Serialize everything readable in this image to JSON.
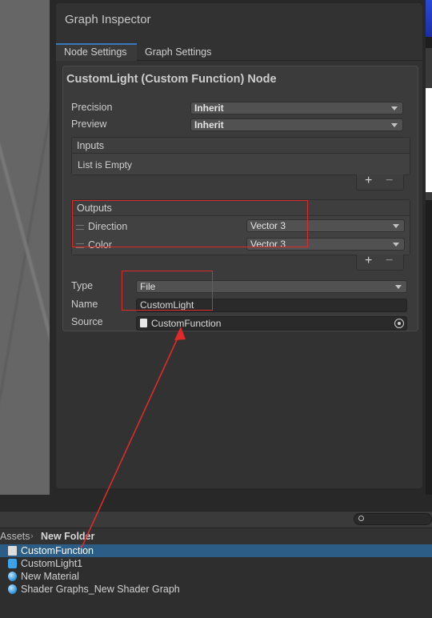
{
  "window": {
    "title": "Graph Inspector"
  },
  "tabs": [
    {
      "label": "Node Settings",
      "active": true
    },
    {
      "label": "Graph Settings",
      "active": false
    }
  ],
  "node": {
    "title": "CustomLight (Custom Function) Node",
    "precision": {
      "label": "Precision",
      "value": "Inherit"
    },
    "preview": {
      "label": "Preview",
      "value": "Inherit"
    },
    "inputs": {
      "header": "Inputs",
      "empty_text": "List is Empty"
    },
    "outputs": {
      "header": "Outputs",
      "items": [
        {
          "name": "Direction",
          "type": "Vector 3"
        },
        {
          "name": "Color",
          "type": "Vector 3"
        }
      ]
    },
    "add_symbol": "+",
    "remove_symbol": "−",
    "type": {
      "label": "Type",
      "value": "File"
    },
    "name_field": {
      "label": "Name",
      "value": "CustomLight"
    },
    "source": {
      "label": "Source",
      "value": "CustomFunction"
    }
  },
  "project": {
    "breadcrumb": {
      "root": "Assets",
      "separator": "›",
      "folder": "New Folder"
    },
    "files": [
      {
        "name": "CustomFunction",
        "icon": "text-file-icon",
        "selected": true
      },
      {
        "name": "CustomLight1",
        "icon": "shader-icon",
        "selected": false
      },
      {
        "name": "New Material",
        "icon": "material-sphere-icon",
        "selected": false
      },
      {
        "name": "Shader Graphs_New Shader Graph",
        "icon": "material-sphere-icon",
        "selected": false
      }
    ]
  },
  "colors": {
    "annotation": "#e02a2a",
    "selection": "#2c5d87",
    "tab_accent": "#3a79bb"
  }
}
